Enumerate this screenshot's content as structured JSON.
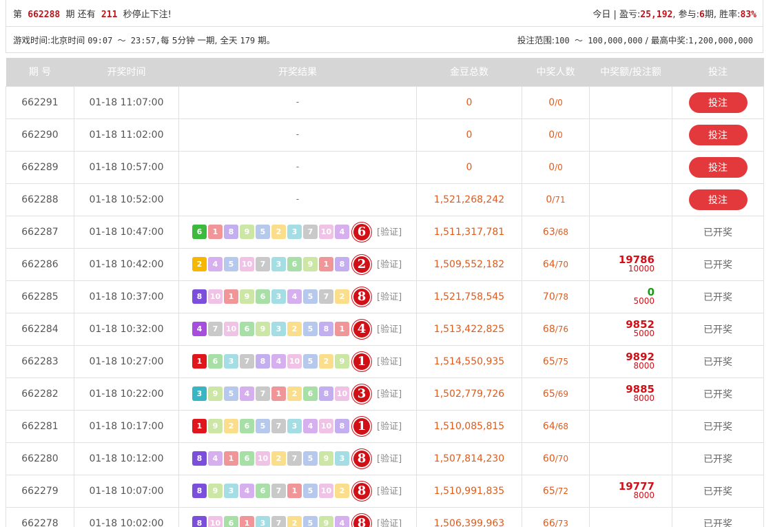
{
  "header": {
    "prefix": "第",
    "issue": "662288",
    "mid": "期 还有",
    "seconds": "211",
    "suffix": "秒停止下注!",
    "today_label": "今日 | 盈亏:",
    "profit": "25,192",
    "participate_label": ", 参与:",
    "participate": "6",
    "period_label": "期, 胜率:",
    "win_rate": "83%"
  },
  "info": {
    "game_time_label": "游戏时间:",
    "game_time_city": "北京时间",
    "game_time_range": "09:07 ～ 23:57,",
    "game_time_rule": "每 5分钟 一期, 全天",
    "total_issues": "179",
    "issue_unit": "期。",
    "bet_range_label": "投注范围:",
    "bet_range": "100 ～ 100,000,000",
    "max_label": "/ 最高中奖:",
    "max_win": "1,200,000,000"
  },
  "columns": [
    "期 号",
    "开奖时间",
    "开奖结果",
    "金豆总数",
    "中奖人数",
    "中奖额/投注额",
    "投注"
  ],
  "colors": {
    "b1": "#e0161c",
    "b2": "#f5b700",
    "b3": "#39b5c4",
    "b4": "#a64fdc",
    "b5": "#5f88d8",
    "b6": "#3db93d",
    "b7": "#8a8a8a",
    "b8": "#7b4fdc",
    "b9": "#8fcc3a",
    "b10": "#e07ac8"
  },
  "bet_label": "投注",
  "opened_label": "已开奖",
  "verify_label": "[验证]",
  "pending_label": "-",
  "rows": [
    {
      "issue": "662291",
      "time": "01-18 11:07:00",
      "balls": [],
      "result": "",
      "total": "0",
      "win": "0",
      "players": "0",
      "ratio_win": "",
      "ratio_bet": "",
      "status": "bet"
    },
    {
      "issue": "662290",
      "time": "01-18 11:02:00",
      "balls": [],
      "result": "",
      "total": "0",
      "win": "0",
      "players": "0",
      "ratio_win": "",
      "ratio_bet": "",
      "status": "bet"
    },
    {
      "issue": "662289",
      "time": "01-18 10:57:00",
      "balls": [],
      "result": "",
      "total": "0",
      "win": "0",
      "players": "0",
      "ratio_win": "",
      "ratio_bet": "",
      "status": "bet"
    },
    {
      "issue": "662288",
      "time": "01-18 10:52:00",
      "balls": [],
      "result": "",
      "total": "1,521,268,242",
      "win": "0",
      "players": "71",
      "ratio_win": "",
      "ratio_bet": "",
      "status": "bet"
    },
    {
      "issue": "662287",
      "time": "01-18 10:47:00",
      "balls": [
        "6",
        "1",
        "8",
        "9",
        "5",
        "2",
        "3",
        "7",
        "10",
        "4"
      ],
      "result": "6",
      "total": "1,511,317,781",
      "win": "63",
      "players": "68",
      "ratio_win": "",
      "ratio_bet": "",
      "status": "opened"
    },
    {
      "issue": "662286",
      "time": "01-18 10:42:00",
      "balls": [
        "2",
        "4",
        "5",
        "10",
        "7",
        "3",
        "6",
        "9",
        "1",
        "8"
      ],
      "result": "2",
      "total": "1,509,552,182",
      "win": "64",
      "players": "70",
      "ratio_win": "19786",
      "ratio_bet": "10000",
      "status": "opened"
    },
    {
      "issue": "662285",
      "time": "01-18 10:37:00",
      "balls": [
        "8",
        "10",
        "1",
        "9",
        "6",
        "3",
        "4",
        "5",
        "7",
        "2"
      ],
      "result": "8",
      "total": "1,521,758,545",
      "win": "70",
      "players": "78",
      "ratio_win": "0",
      "ratio_bet": "5000",
      "status": "opened"
    },
    {
      "issue": "662284",
      "time": "01-18 10:32:00",
      "balls": [
        "4",
        "7",
        "10",
        "6",
        "9",
        "3",
        "2",
        "5",
        "8",
        "1"
      ],
      "result": "4",
      "total": "1,513,422,825",
      "win": "68",
      "players": "76",
      "ratio_win": "9852",
      "ratio_bet": "5000",
      "status": "opened"
    },
    {
      "issue": "662283",
      "time": "01-18 10:27:00",
      "balls": [
        "1",
        "6",
        "3",
        "7",
        "8",
        "4",
        "10",
        "5",
        "2",
        "9"
      ],
      "result": "1",
      "total": "1,514,550,935",
      "win": "65",
      "players": "75",
      "ratio_win": "9892",
      "ratio_bet": "8000",
      "status": "opened"
    },
    {
      "issue": "662282",
      "time": "01-18 10:22:00",
      "balls": [
        "3",
        "9",
        "5",
        "4",
        "7",
        "1",
        "2",
        "6",
        "8",
        "10"
      ],
      "result": "3",
      "total": "1,502,779,726",
      "win": "65",
      "players": "69",
      "ratio_win": "9885",
      "ratio_bet": "8000",
      "status": "opened"
    },
    {
      "issue": "662281",
      "time": "01-18 10:17:00",
      "balls": [
        "1",
        "9",
        "2",
        "6",
        "5",
        "7",
        "3",
        "4",
        "10",
        "8"
      ],
      "result": "1",
      "total": "1,510,085,815",
      "win": "64",
      "players": "68",
      "ratio_win": "",
      "ratio_bet": "",
      "status": "opened"
    },
    {
      "issue": "662280",
      "time": "01-18 10:12:00",
      "balls": [
        "8",
        "4",
        "1",
        "6",
        "10",
        "2",
        "7",
        "5",
        "9",
        "3"
      ],
      "result": "8",
      "total": "1,507,814,230",
      "win": "60",
      "players": "70",
      "ratio_win": "",
      "ratio_bet": "",
      "status": "opened"
    },
    {
      "issue": "662279",
      "time": "01-18 10:07:00",
      "balls": [
        "8",
        "9",
        "3",
        "4",
        "6",
        "7",
        "1",
        "5",
        "10",
        "2"
      ],
      "result": "8",
      "total": "1,510,991,835",
      "win": "65",
      "players": "72",
      "ratio_win": "19777",
      "ratio_bet": "8000",
      "status": "opened"
    },
    {
      "issue": "662278",
      "time": "01-18 10:02:00",
      "balls": [
        "8",
        "10",
        "6",
        "1",
        "3",
        "7",
        "2",
        "5",
        "9",
        "4"
      ],
      "result": "8",
      "total": "1,506,399,963",
      "win": "66",
      "players": "73",
      "ratio_win": "",
      "ratio_bet": "",
      "status": "opened"
    }
  ]
}
